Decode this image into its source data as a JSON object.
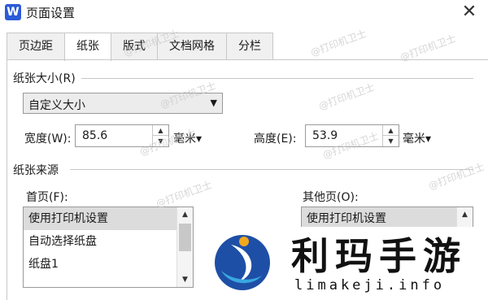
{
  "window": {
    "app_icon_letter": "W",
    "title": "页面设置"
  },
  "tabs": [
    {
      "label": "页边距"
    },
    {
      "label": "纸张",
      "active": true
    },
    {
      "label": "版式"
    },
    {
      "label": "文档网格"
    },
    {
      "label": "分栏"
    }
  ],
  "paper_size": {
    "section_title": "纸张大小(R)",
    "dropdown_value": "自定义大小",
    "width_label": "宽度(W):",
    "width_value": "85.6",
    "width_unit": "毫米▾",
    "height_label": "高度(E):",
    "height_value": "53.9",
    "height_unit": "毫米▾"
  },
  "paper_source": {
    "section_title": "纸张来源",
    "first_page_label": "首页(F):",
    "first_page_items": [
      "使用打印机设置",
      "自动选择纸盘",
      "纸盘1"
    ],
    "other_pages_label": "其他页(O):",
    "other_pages_items": [
      "使用打印机设置"
    ]
  },
  "watermark_text": "@打印机卫士",
  "logo": {
    "title": "利玛手游",
    "subtitle": "limakeji.info"
  }
}
